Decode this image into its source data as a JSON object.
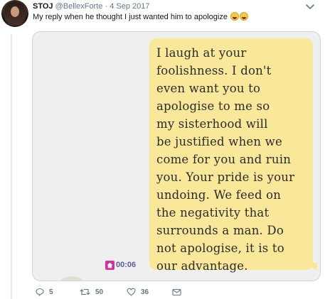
{
  "tweet": {
    "author_name": "STOJ",
    "author_handle": "@BellexForte",
    "separator": "·",
    "date": "4 Sep 2017",
    "text": "My reply when he thought I just wanted him to apologize"
  },
  "media": {
    "message_lines": [
      "I laugh at your",
      "foolishness. I don't",
      "even want you to",
      "apologise to me so",
      "my sisterhood will",
      "be justified when we",
      "come for you and ruin",
      "you. Your pride is your",
      "undoing. We feed on",
      "the negativity that",
      "surrounds a man. Do",
      "not apologise, it is to",
      "our advantage."
    ],
    "timestamp": "00:06",
    "bubble_color": "#f9e79a"
  },
  "actions": {
    "reply_count": "5",
    "retweet_count": "50",
    "like_count": "36"
  },
  "icons": {
    "menu": "chevron-down-icon",
    "reply": "reply-icon",
    "retweet": "retweet-icon",
    "like": "heart-icon",
    "dm": "envelope-icon",
    "status": "home-icon"
  }
}
